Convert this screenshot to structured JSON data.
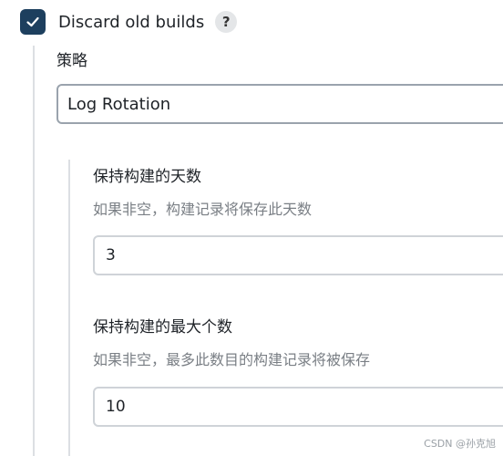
{
  "discard_old_builds": {
    "label": "Discard old builds",
    "checked": true,
    "help": "?"
  },
  "strategy": {
    "label": "策略",
    "selected": "Log Rotation"
  },
  "days_to_keep": {
    "label": "保持构建的天数",
    "hint": "如果非空，构建记录将保存此天数",
    "value": "3"
  },
  "max_builds": {
    "label": "保持构建的最大个数",
    "hint": "如果非空，最多此数目的构建记录将被保存",
    "value": "10"
  },
  "watermark": "CSDN @孙克旭",
  "colors": {
    "checkbox": "#1d3f5e",
    "select_border": "#9aa3ad",
    "input_border": "#cfd3d8",
    "hint_text": "#7a7f85"
  }
}
